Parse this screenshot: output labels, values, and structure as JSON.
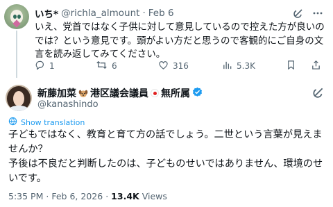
{
  "reply": {
    "name": "いち*",
    "handle": "@richla_almount",
    "separator": "·",
    "date": "Feb 6",
    "body": "いえ、党首ではなく子供に対して意見しているので控えた方が良いのでは？という意見です。頭がよい方だと思うので客観的にご自身の文言を読み返してみてください。",
    "icons": [
      "grok-icon",
      "more-icon"
    ],
    "actions": {
      "reply_count": "1",
      "retweet_count": "6",
      "like_count": "316",
      "views_count": "5.3K"
    }
  },
  "main": {
    "name": "新藤加菜",
    "name_suffix": "港区議会議員",
    "name_suffix2": "無所属",
    "handle": "@kanashindo",
    "show_translation": "Show translation",
    "body": "子どもではなく、教育と育て方の話でしょう。二世という言葉が見えませんか？\n予後は不良だと判断したのは、子どものせいではありません、環境のせいです。",
    "time": "5:35 PM",
    "separator": "·",
    "date": "Feb 6, 2026",
    "views_count": "13.4K",
    "views_label": "Views"
  },
  "colors": {
    "accent": "#1d9bf0",
    "muted": "#536471",
    "text": "#0f1419",
    "verified": "#1d9bf0"
  }
}
